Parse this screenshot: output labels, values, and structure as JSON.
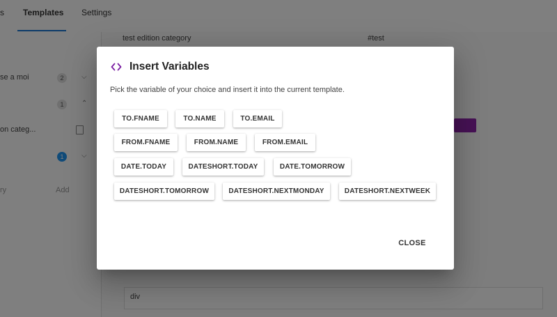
{
  "colors": {
    "accent": "#1976d2",
    "brand_purple": "#7b1fa2",
    "backdrop": "rgba(0,0,0,0.5)"
  },
  "topbar": {
    "tabs": [
      {
        "label": "s"
      },
      {
        "label": "Templates"
      },
      {
        "label": "Settings"
      }
    ]
  },
  "sidebar": {
    "items": [
      {
        "label": "se a moi",
        "count": "2"
      },
      {
        "label": "",
        "count": "1"
      },
      {
        "label": "on categ..."
      },
      {
        "label": "",
        "count": "1"
      }
    ],
    "bottom_left": "ry",
    "bottom_right": "Add"
  },
  "content": {
    "row_label": "test edition category",
    "row_value": "#test",
    "bottom_value": "div"
  },
  "dialog": {
    "icon": "code-icon",
    "title": "Insert Variables",
    "description": "Pick the variable of your choice and insert it into the current template.",
    "rows": [
      [
        "TO.FNAME",
        "TO.NAME",
        "TO.EMAIL"
      ],
      [
        "FROM.FNAME",
        "FROM.NAME",
        "FROM.EMAIL"
      ],
      [
        "DATE.TODAY",
        "DATESHORT.TODAY",
        "DATE.TOMORROW"
      ],
      [
        "DATESHORT.TOMORROW",
        "DATESHORT.NEXTMONDAY",
        "DATESHORT.NEXTWEEK"
      ]
    ],
    "close_label": "CLOSE"
  }
}
